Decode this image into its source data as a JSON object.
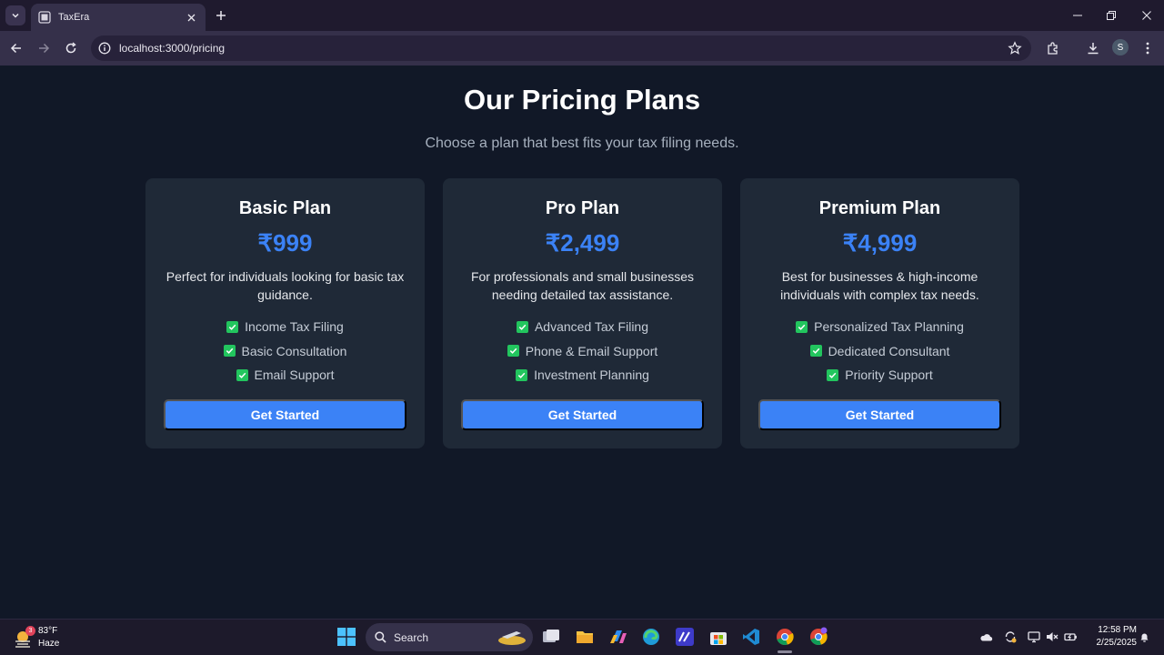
{
  "browser": {
    "tab_title": "TaxEra",
    "url": "localhost:3000/pricing",
    "profile_initial": "S"
  },
  "page": {
    "title": "Our Pricing Plans",
    "subtitle": "Choose a plan that best fits your tax filing needs.",
    "plans": [
      {
        "name": "Basic Plan",
        "price": "₹999",
        "description": "Perfect for individuals looking for basic tax guidance.",
        "features": [
          "Income Tax Filing",
          "Basic Consultation",
          "Email Support"
        ],
        "cta": "Get Started"
      },
      {
        "name": "Pro Plan",
        "price": "₹2,499",
        "description": "For professionals and small businesses needing detailed tax assistance.",
        "features": [
          "Advanced Tax Filing",
          "Phone & Email Support",
          "Investment Planning"
        ],
        "cta": "Get Started"
      },
      {
        "name": "Premium Plan",
        "price": "₹4,999",
        "description": "Best for businesses & high-income individuals with complex tax needs.",
        "features": [
          "Personalized Tax Planning",
          "Dedicated Consultant",
          "Priority Support"
        ],
        "cta": "Get Started"
      }
    ]
  },
  "taskbar": {
    "weather_temp": "83°F",
    "weather_condition": "Haze",
    "weather_badge": "3",
    "search_label": "Search",
    "time": "12:58 PM",
    "date": "2/25/2025"
  },
  "colors": {
    "page_bg": "#111827",
    "card_bg": "#1f2937",
    "accent": "#3b82f6",
    "check": "#22c55e"
  }
}
